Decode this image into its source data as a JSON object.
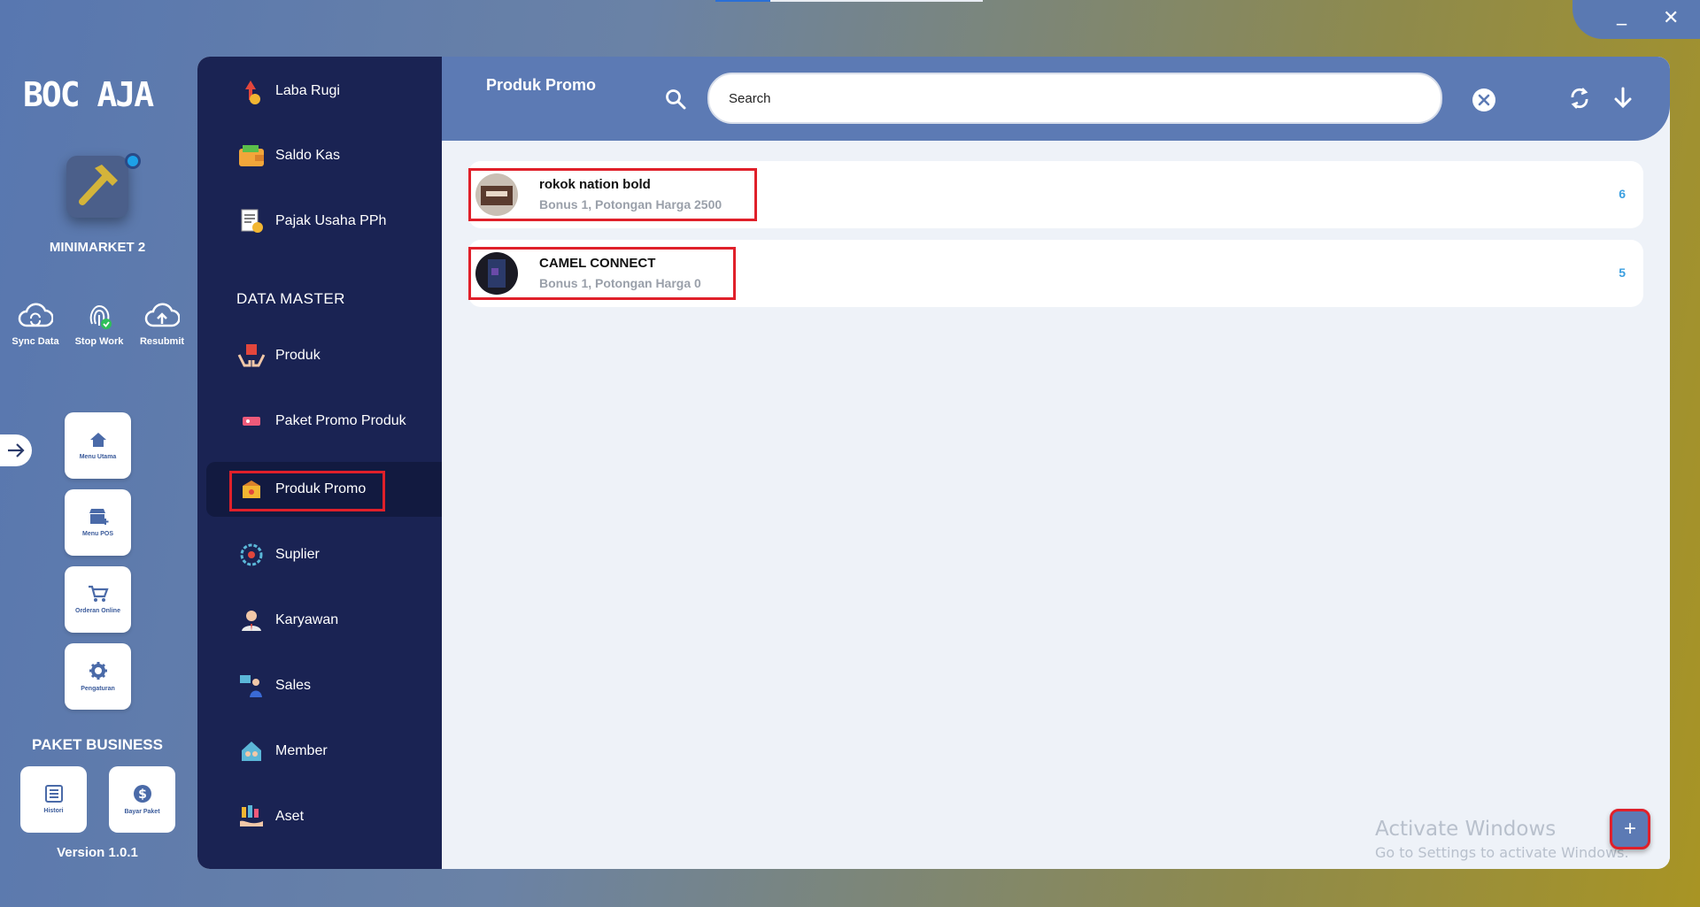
{
  "window": {
    "minimize_label": "_",
    "close_label": "✕"
  },
  "brand": {
    "logo_text": "BOC AJA",
    "store_name": "MINIMARKET 2"
  },
  "quick_actions": [
    {
      "label": "Sync Data",
      "icon": "cloud-sync-icon"
    },
    {
      "label": "Stop Work",
      "icon": "fingerprint-icon"
    },
    {
      "label": "Resubmit",
      "icon": "cloud-upload-icon"
    }
  ],
  "nav_tiles": [
    {
      "label": "Menu Utama",
      "icon": "home-icon"
    },
    {
      "label": "Menu POS",
      "icon": "store-icon"
    },
    {
      "label": "Orderan Online",
      "icon": "cart-icon"
    },
    {
      "label": "Pengaturan",
      "icon": "gear-icon"
    }
  ],
  "paket": {
    "title": "PAKET BUSINESS",
    "tiles": [
      {
        "label": "Histori",
        "icon": "list-icon"
      },
      {
        "label": "Bayar Paket",
        "icon": "dollar-icon"
      }
    ]
  },
  "version": "Version 1.0.1",
  "sidebar": {
    "section_label": "DATA MASTER",
    "items": [
      {
        "label": "Laba Rugi",
        "icon": "profit-icon"
      },
      {
        "label": "Saldo Kas",
        "icon": "wallet-icon"
      },
      {
        "label": "Pajak Usaha PPh",
        "icon": "tax-icon"
      },
      {
        "label": "Produk",
        "icon": "product-icon"
      },
      {
        "label": "Paket Promo Produk",
        "icon": "promo-ticket-icon"
      },
      {
        "label": "Produk Promo",
        "icon": "promo-box-icon"
      },
      {
        "label": "Suplier",
        "icon": "supplier-icon"
      },
      {
        "label": "Karyawan",
        "icon": "employee-icon"
      },
      {
        "label": "Sales",
        "icon": "sales-icon"
      },
      {
        "label": "Member",
        "icon": "member-icon"
      },
      {
        "label": "Aset",
        "icon": "asset-icon"
      }
    ]
  },
  "header": {
    "title": "Produk Promo",
    "search_value": "Search"
  },
  "promos": [
    {
      "name": "rokok nation bold",
      "desc": "Bonus 1, Potongan Harga 2500",
      "qty": "6"
    },
    {
      "name": "CAMEL CONNECT",
      "desc": "Bonus 1, Potongan Harga 0",
      "qty": "5"
    }
  ],
  "watermark": {
    "line1": "Activate Windows",
    "line2": "Go to Settings to activate Windows."
  },
  "fab_label": "+",
  "colors": {
    "sidebar": "#1a2353",
    "header": "#5c7ab4",
    "highlight": "#e0202a",
    "qty": "#3b9fe0"
  }
}
